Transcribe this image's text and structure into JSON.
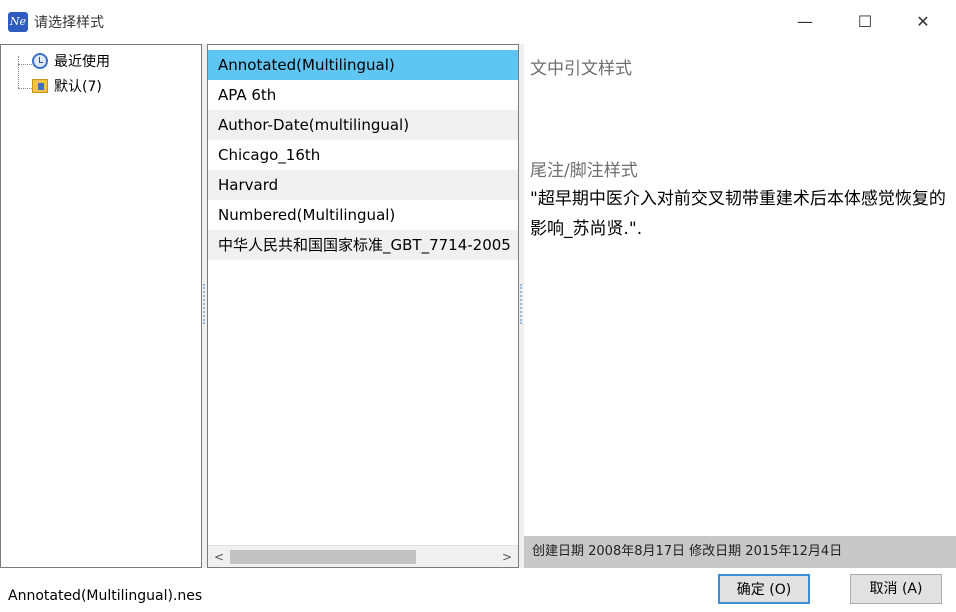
{
  "window": {
    "icon_text": "Ne",
    "title": "请选择样式",
    "minimize": "—",
    "maximize": "☐",
    "close": "✕"
  },
  "tree": {
    "items": [
      {
        "label": "最近使用",
        "icon": "clock-icon"
      },
      {
        "label": "默认(7)",
        "icon": "folder-icon"
      }
    ]
  },
  "styles": {
    "items": [
      {
        "label": "Annotated(Multilingual)",
        "selected": true
      },
      {
        "label": "APA 6th"
      },
      {
        "label": "Author-Date(multilingual)"
      },
      {
        "label": "Chicago_16th"
      },
      {
        "label": "Harvard"
      },
      {
        "label": "Numbered(Multilingual)"
      },
      {
        "label": "中华人民共和国国家标准_GBT_7714-2005"
      }
    ],
    "scroll_left": "<",
    "scroll_right": ">"
  },
  "preview": {
    "citation_heading": "文中引文样式",
    "footnote_heading": "尾注/脚注样式",
    "footnote_text": "\"超早期中医介入对前交叉韧带重建术后本体感觉恢复的影响_苏尚贤.\".",
    "info": "创建日期  2008年8月17日   修改日期  2015年12月4日"
  },
  "footer": {
    "file_name": "Annotated(Multilingual).nes",
    "ok_label": "确定 (O)",
    "cancel_label": "取消 (A)"
  },
  "colors": {
    "selection": "#5fc6f3",
    "alt_row": "#f0f0f0",
    "info_bar": "#c8c8c8"
  }
}
